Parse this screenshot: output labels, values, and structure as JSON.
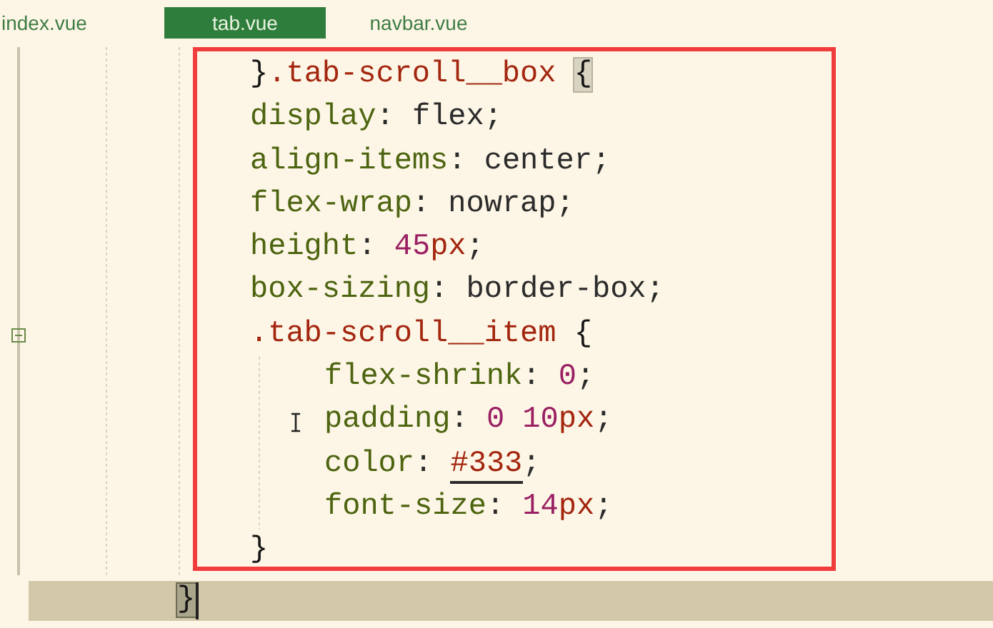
{
  "tabs": [
    {
      "label": "index.vue",
      "selected": false
    },
    {
      "label": "tab.vue",
      "selected": true
    },
    {
      "label": "navbar.vue",
      "selected": false
    }
  ],
  "code": {
    "lines": [
      {
        "tokens": [
          {
            "kind": "brace",
            "text": "}"
          },
          {
            "kind": "selector",
            "text": ".tab-scroll__box"
          },
          {
            "kind": "brace",
            "text": "{",
            "gap": true,
            "matched": true
          }
        ]
      },
      {
        "tokens": [
          {
            "kind": "prop",
            "text": "display"
          },
          {
            "kind": "punct",
            "text": ": "
          },
          {
            "kind": "value",
            "text": "flex"
          },
          {
            "kind": "punct",
            "text": ";"
          }
        ]
      },
      {
        "tokens": [
          {
            "kind": "prop",
            "text": "align-items"
          },
          {
            "kind": "punct",
            "text": ": "
          },
          {
            "kind": "value",
            "text": "center"
          },
          {
            "kind": "punct",
            "text": ";"
          }
        ]
      },
      {
        "tokens": [
          {
            "kind": "prop",
            "text": "flex-wrap"
          },
          {
            "kind": "punct",
            "text": ": "
          },
          {
            "kind": "value",
            "text": "nowrap"
          },
          {
            "kind": "punct",
            "text": ";"
          }
        ]
      },
      {
        "tokens": [
          {
            "kind": "prop",
            "text": "height"
          },
          {
            "kind": "punct",
            "text": ": "
          },
          {
            "kind": "number",
            "text": "45"
          },
          {
            "kind": "unit",
            "text": "px"
          },
          {
            "kind": "punct",
            "text": ";"
          }
        ]
      },
      {
        "tokens": [
          {
            "kind": "prop",
            "text": "box-sizing"
          },
          {
            "kind": "punct",
            "text": ": "
          },
          {
            "kind": "value",
            "text": "border-box"
          },
          {
            "kind": "punct",
            "text": ";"
          }
        ]
      },
      {
        "tokens": [
          {
            "kind": "selector",
            "text": ".tab-scroll__item"
          },
          {
            "kind": "brace",
            "text": "{",
            "gap": true
          }
        ],
        "foldable": true,
        "children": [
          {
            "tokens": [
              {
                "kind": "prop",
                "text": "flex-shrink"
              },
              {
                "kind": "punct",
                "text": ": "
              },
              {
                "kind": "number",
                "text": "0"
              },
              {
                "kind": "punct",
                "text": ";"
              }
            ]
          },
          {
            "tokens": [
              {
                "kind": "prop",
                "text": "padding"
              },
              {
                "kind": "punct",
                "text": ": "
              },
              {
                "kind": "number",
                "text": "0"
              },
              {
                "kind": "number",
                "text": "10",
                "gap": true
              },
              {
                "kind": "unit",
                "text": "px"
              },
              {
                "kind": "punct",
                "text": ";"
              }
            ],
            "pointer": true
          },
          {
            "tokens": [
              {
                "kind": "prop",
                "text": "color"
              },
              {
                "kind": "punct",
                "text": ": "
              },
              {
                "kind": "color",
                "text": "#333"
              },
              {
                "kind": "punct",
                "text": ";"
              }
            ]
          },
          {
            "tokens": [
              {
                "kind": "prop",
                "text": "font-size"
              },
              {
                "kind": "punct",
                "text": ": "
              },
              {
                "kind": "number",
                "text": "14"
              },
              {
                "kind": "unit",
                "text": "px"
              },
              {
                "kind": "punct",
                "text": ";"
              }
            ]
          }
        ]
      },
      {
        "tokens": [
          {
            "kind": "brace",
            "text": "}"
          }
        ]
      }
    ],
    "current_line": {
      "tokens": [
        {
          "kind": "brace",
          "text": "}",
          "matched": true
        }
      ]
    }
  }
}
